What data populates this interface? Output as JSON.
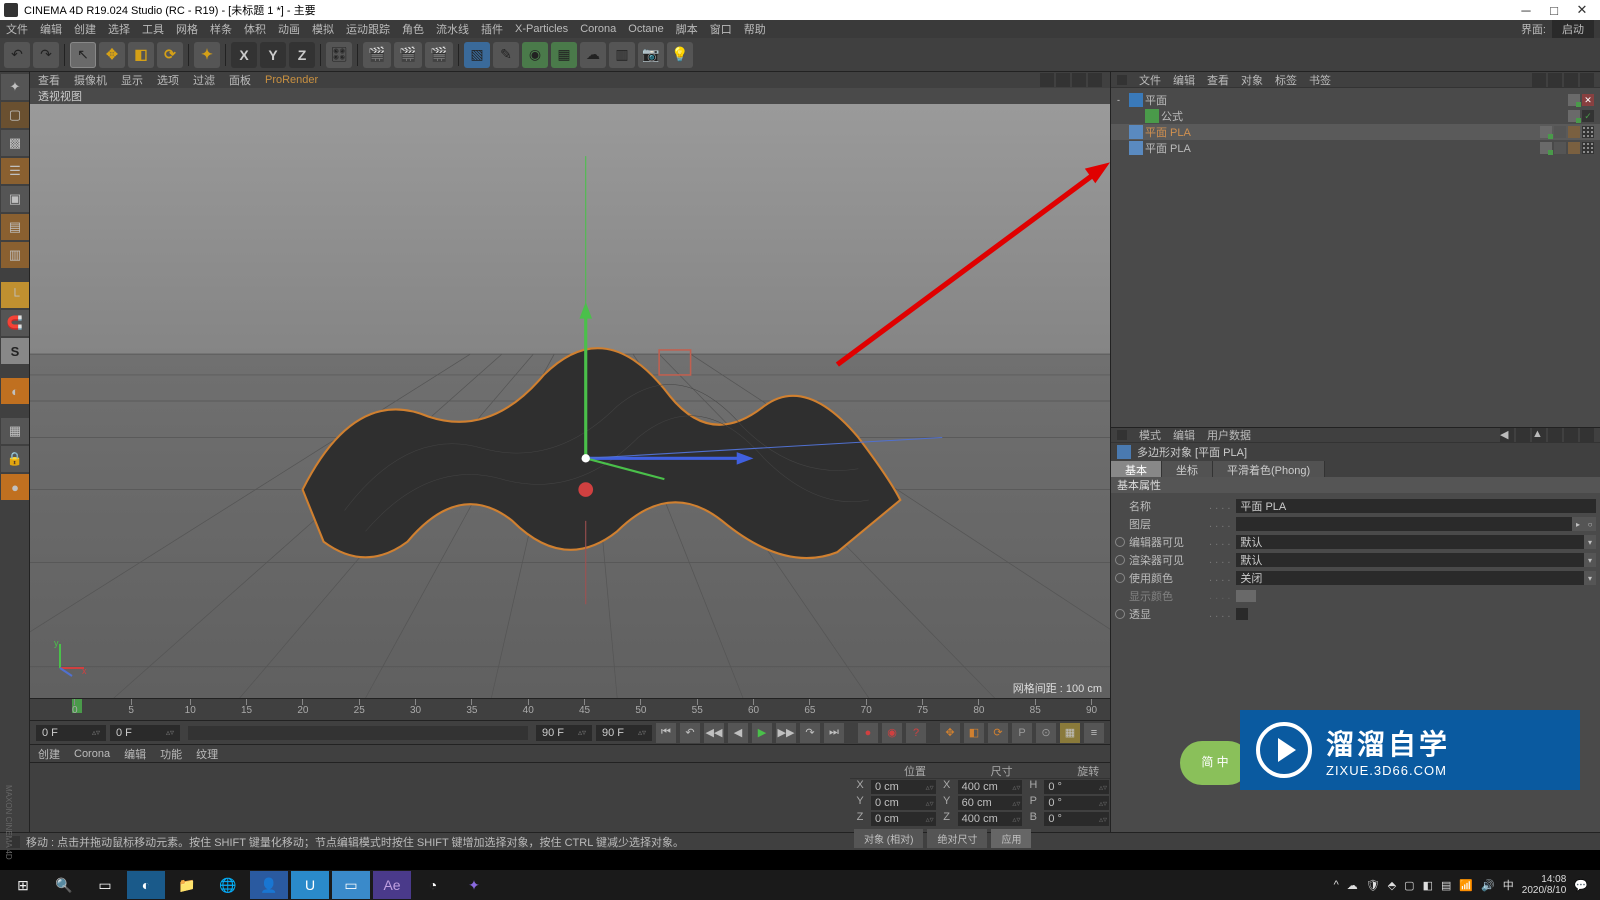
{
  "title": "CINEMA 4D R19.024 Studio (RC - R19) - [未标题 1 *] - 主要",
  "menubar": [
    "文件",
    "编辑",
    "创建",
    "选择",
    "工具",
    "网格",
    "样条",
    "体积",
    "动画",
    "模拟",
    "运动跟踪",
    "角色",
    "流水线",
    "插件",
    "X-Particles",
    "Corona",
    "Octane",
    "脚本",
    "窗口",
    "帮助"
  ],
  "menubar_right_label": "界面:",
  "menubar_right_value": "启动",
  "vp_tabs": [
    "查看",
    "摄像机",
    "显示",
    "选项",
    "过滤",
    "面板",
    "ProRender"
  ],
  "vp_name": "透视视图",
  "vp_grid_label": "网格间距 : 100 cm",
  "timeline": {
    "start_label": "0 F",
    "current": "0 F",
    "end_label": "90 F",
    "after": "90 F",
    "ticks": [
      "0",
      "5",
      "10",
      "15",
      "20",
      "25",
      "30",
      "35",
      "40",
      "45",
      "50",
      "55",
      "60",
      "65",
      "70",
      "75",
      "80",
      "85",
      "90"
    ]
  },
  "bottom_tabs": [
    "创建",
    "Corona",
    "编辑",
    "功能",
    "纹理"
  ],
  "coord": {
    "headers": [
      "位置",
      "尺寸",
      "旋转"
    ],
    "rows": [
      {
        "k": "X",
        "p": "0 cm",
        "s": "X",
        "sv": "400 cm",
        "r": "H",
        "rv": "0 °"
      },
      {
        "k": "Y",
        "p": "0 cm",
        "s": "Y",
        "sv": "60 cm",
        "r": "P",
        "rv": "0 °"
      },
      {
        "k": "Z",
        "p": "0 cm",
        "s": "Z",
        "sv": "400 cm",
        "r": "B",
        "rv": "0 °"
      }
    ],
    "mode1": "对象 (相对)",
    "mode2": "绝对尺寸",
    "apply": "应用"
  },
  "status": "移动 : 点击并拖动鼠标移动元素。按住 SHIFT 键量化移动；节点编辑模式时按住 SHIFT 键增加选择对象，按住 CTRL 键减少选择对象。",
  "om_tabs": [
    "文件",
    "编辑",
    "查看",
    "对象",
    "标签",
    "书签"
  ],
  "om_tree": [
    {
      "indent": 0,
      "expand": "-",
      "icon": "plane",
      "name": "平面",
      "sel": false,
      "tags": [
        "g",
        "x"
      ]
    },
    {
      "indent": 1,
      "expand": "",
      "icon": "fx",
      "name": "公式",
      "sel": false,
      "tags": [
        "g",
        "chk"
      ]
    },
    {
      "indent": 0,
      "expand": "",
      "icon": "poly",
      "name": "平面 PLA",
      "sel": true,
      "tags": [
        "g",
        "blank",
        "d",
        "pat"
      ]
    },
    {
      "indent": 0,
      "expand": "",
      "icon": "poly",
      "name": "平面 PLA",
      "sel": false,
      "tags": [
        "g",
        "blank",
        "d",
        "pat"
      ]
    }
  ],
  "attr_tabs": [
    "模式",
    "编辑",
    "用户数据"
  ],
  "attr_title": "多边形对象 [平面 PLA]",
  "attr_subtabs": [
    "基本",
    "坐标",
    "平滑着色(Phong)"
  ],
  "attr_section": "基本属性",
  "attr_props": [
    {
      "dot": false,
      "label": "名称",
      "value": "平面 PLA",
      "type": "text"
    },
    {
      "dot": false,
      "label": "图层",
      "value": "",
      "type": "text_btn"
    },
    {
      "dot": true,
      "label": "编辑器可见",
      "value": "默认",
      "type": "drop"
    },
    {
      "dot": true,
      "label": "渲染器可见",
      "value": "默认",
      "type": "drop"
    },
    {
      "dot": true,
      "label": "使用颜色",
      "value": "关闭",
      "type": "drop"
    },
    {
      "dot": false,
      "label": "显示颜色",
      "value": "",
      "type": "color",
      "dim": true
    },
    {
      "dot": true,
      "label": "透显",
      "value": "",
      "type": "check"
    }
  ],
  "watermark": {
    "line1": "溜溜自学",
    "line2": "ZIXUE.3D66.COM"
  },
  "bubble": "简\n中",
  "taskbar": {
    "time": "14:08",
    "date": "2020/8/10",
    "lang": "中"
  }
}
